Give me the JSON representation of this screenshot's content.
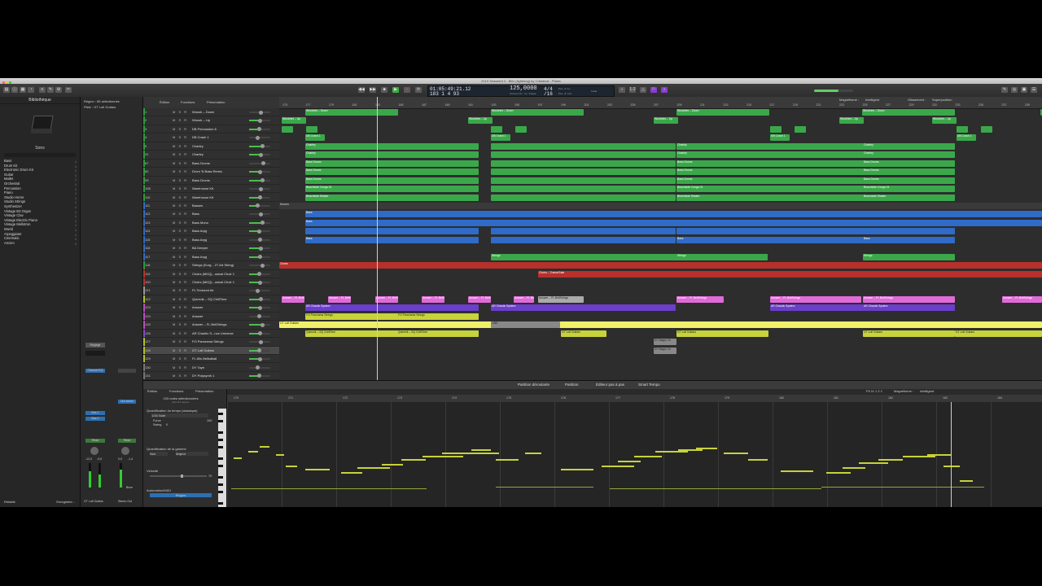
{
  "window": {
    "title": "2019 Seaweed 3 - Blitz (lightning) by Collateral - Pistes"
  },
  "lcd": {
    "time": "01:05:49:21.12",
    "bars": "183  1  4  93",
    "tempo": "125,0000",
    "sig": "4/4",
    "div": "/16",
    "punch_in": "Pos d'in",
    "punch_out": "Pos d'out",
    "sub_tempo": "Conserver le tempo",
    "sub_sig": "Coma"
  },
  "library": {
    "title": "Bibliothèque",
    "section": "Sons",
    "items": [
      "Bass",
      "Drum Kit",
      "Electronic Drum Kit",
      "Guitar",
      "Mallet",
      "Orchestral",
      "Percussion",
      "Piano",
      "Studio Horns",
      "Studio Strings",
      "Synthesizer",
      "Vintage B3 Organ",
      "Vintage Clav",
      "Vintage Electric Piano",
      "Vintage Mellotron",
      "World",
      "Arpeggiator",
      "Cinematic",
      "Ancien"
    ],
    "footer_left": "Rétablir",
    "footer_right": "Enregistrer..."
  },
  "inspector": {
    "region": "Région : 85 sélectionnés",
    "track": "Piste : GT Lofi Guitars",
    "ch1": "GT Lofi Guitars",
    "ch2": "Stereo Out",
    "channel_eq": "Channel EQ",
    "setting": "Réglage",
    "bus1": "Bus 1",
    "bus2": "Bus 2",
    "read": "Read",
    "out": "Out stéréo",
    "bnce": "Bnce",
    "val1": "-12,0",
    "val2": "-9,5",
    "val3": "0,0",
    "val4": "-1,4"
  },
  "arrange_toolbar": {
    "edit": "Édition",
    "functions": "Fonctions",
    "view": "Présentation",
    "magnet": "Magnétisme :",
    "magnet_val": "Intelligent",
    "drag": "Glissement :",
    "drag_val": "Superposition"
  },
  "ruler": [
    "175",
    "177",
    "179",
    "181",
    "183",
    "185",
    "187",
    "189",
    "191",
    "193",
    "195",
    "197",
    "199",
    "201",
    "203",
    "205",
    "207",
    "209",
    "211",
    "213",
    "215",
    "217",
    "219",
    "221",
    "223",
    "225",
    "227",
    "229",
    "231",
    "233",
    "235",
    "237",
    "239"
  ],
  "tracks": [
    {
      "n": "1",
      "name": "Woosh – Down"
    },
    {
      "n": "2",
      "name": "Woosh – Up"
    },
    {
      "n": "3",
      "name": "DB Percussion 6"
    },
    {
      "n": "4",
      "name": "DB Crash 1"
    },
    {
      "n": "5",
      "name": "Charley"
    },
    {
      "n": "31",
      "name": "Charley"
    },
    {
      "n": "67",
      "name": "Bass Drums"
    },
    {
      "n": "82",
      "name": "Drum 'N Bass Remix"
    },
    {
      "n": "93",
      "name": "Bass Drums"
    },
    {
      "n": "108",
      "name": "Warehouse Kit"
    },
    {
      "n": "110",
      "name": "Warehouse Kit"
    },
    {
      "n": "111",
      "name": "Basses"
    },
    {
      "n": "112",
      "name": "Bass"
    },
    {
      "n": "113",
      "name": "Bass Mono"
    },
    {
      "n": "114",
      "name": "Bass Arpg"
    },
    {
      "n": "115",
      "name": "Bass Arpg"
    },
    {
      "n": "116",
      "name": "BA Deeper"
    },
    {
      "n": "117",
      "name": "Bass Arpg"
    },
    {
      "n": "118",
      "name": "Strings (Korg... 27 Art String)"
    },
    {
      "n": "119",
      "name": "Choirs (MKQ)...usical Choir 1"
    },
    {
      "n": "120",
      "name": "Choirs (MKQ)...usical Choir 1"
    },
    {
      "n": "121",
      "name": "FL Textured Air"
    },
    {
      "n": "122",
      "name": "Quimnik – SQ ChillTime"
    },
    {
      "n": "123",
      "name": "Answer"
    },
    {
      "n": "124",
      "name": "Answer"
    },
    {
      "n": "125",
      "name": "Answer – FL BellStrings"
    },
    {
      "n": "126",
      "name": "AR Chaotic S...nce Universe"
    },
    {
      "n": "127",
      "name": "FO Panorama Strings"
    },
    {
      "n": "128",
      "name": "GT Lofi Guitars"
    },
    {
      "n": "129",
      "name": "FL 80s Bellsdball"
    },
    {
      "n": "130",
      "name": "DY Taye"
    },
    {
      "n": "131",
      "name": "DY Polysynth 1"
    }
  ],
  "region_labels": {
    "woosh_down": "Wooshes – Down",
    "woosh_up": "Wooshes – Up",
    "crash": "DB Crash 1",
    "charley": "Charley",
    "bassdrums": "Bass Drums",
    "conga": "Beachside Conga 01",
    "shaker": "Beachside Shaker",
    "basses": "Basses",
    "bass": "Bass",
    "strings": "Strings",
    "choirs": "Choirs",
    "choirs_tg": "Choirs – TranceGate",
    "answer": "Answer – FL BellStrings",
    "chaotic": "AR Chaotic System",
    "panorama": "FO Panorama Strings",
    "quimnik": "Quimnik – SQ ChillTime",
    "lofi": "GT Lofi Guitars",
    "link": "LINK",
    "magic": "DY Magic Ch"
  },
  "tabs": [
    "Partition déroulante",
    "Partition",
    "Éditeur pas à pas",
    "Smart Tempo"
  ],
  "editor": {
    "edit": "Édition",
    "functions": "Fonctions",
    "view": "Présentation",
    "notes_selected": "193 notes sélectionnées",
    "notes_sub": "dans 83 régions",
    "quantize": "Quantification du temps (classique)",
    "quantize_val": "1/16 Note",
    "strength": "Force",
    "strength_val": "100",
    "swing": "Swing",
    "swing_val": "0",
    "scale": "Quantification de la gamme",
    "scale_root": "Non",
    "scale_mode": "Majeur",
    "velocity": "Vélocité",
    "velocity_val": "70",
    "automation": "Automation/MIDI",
    "automation_val": "Région",
    "position": "F5  11 1 2 1",
    "magnet": "Magnétisme :",
    "magnet_val": "Intelligent",
    "ruler": [
      "170",
      "171",
      "172",
      "173",
      "174",
      "175",
      "176",
      "177",
      "178",
      "179",
      "180",
      "181",
      "182",
      "183",
      "184"
    ]
  }
}
